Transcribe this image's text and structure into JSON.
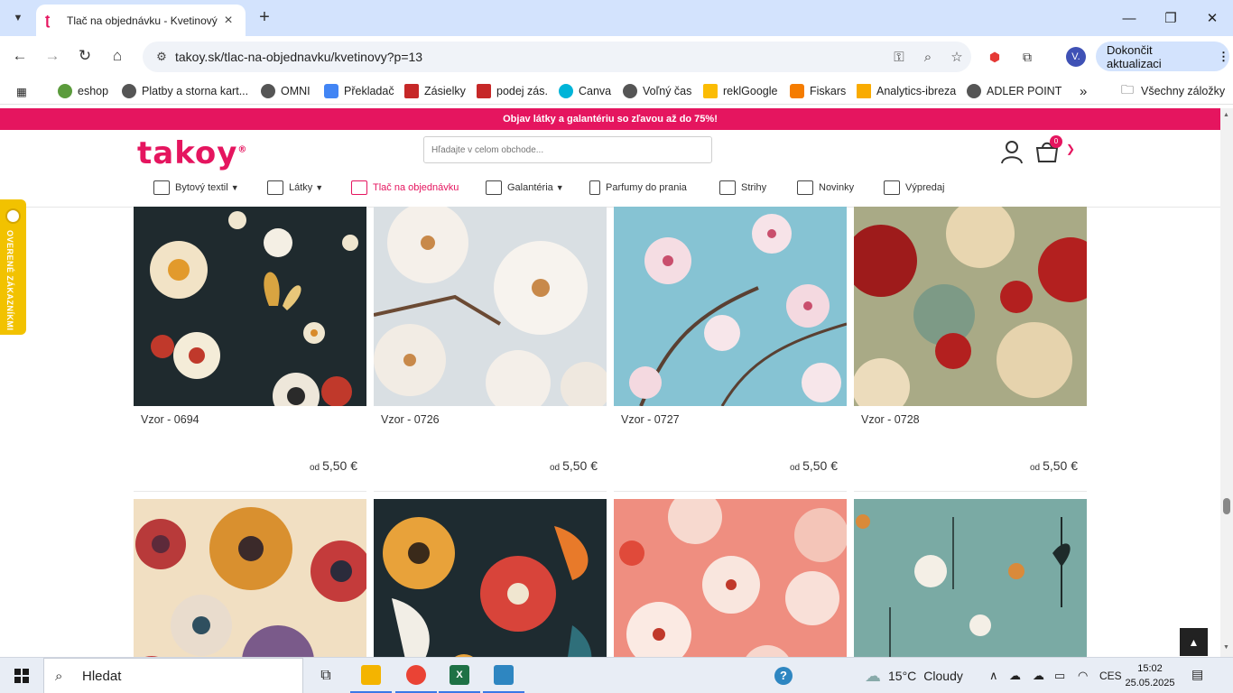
{
  "browser": {
    "tab_title": "Tlač na objednávku - Kvetinový",
    "url": "takoy.sk/tlac-na-objednavku/kvetinovy?p=13",
    "update_button": "Dokončit aktualizaci",
    "profile_initial": "V.",
    "bookmarks": [
      "eshop",
      "Platby a storna kart...",
      "OMNI",
      "Překladač",
      "Zásielky",
      "podej zás.",
      "Canva",
      "Voľný čas",
      "reklGoogle",
      "Fiskars",
      "Analytics-ibreza",
      "ADLER POINT"
    ],
    "all_bookmarks": "Všechny záložky"
  },
  "site": {
    "promo": "Objav látky a galantériu so zľavou až do 75%!",
    "logo": "takoy",
    "logo_mark": "®",
    "search_placeholder": "Hľadajte v celom obchode...",
    "cart_count": "0",
    "nav": [
      {
        "label": "Bytový textil",
        "has_menu": true
      },
      {
        "label": "Látky",
        "has_menu": true
      },
      {
        "label": "Tlač na objednávku",
        "has_menu": false,
        "active": true
      },
      {
        "label": "Galantéria",
        "has_menu": true
      },
      {
        "label": "Parfumy do prania",
        "has_menu": false
      },
      {
        "label": "Strihy",
        "has_menu": false
      },
      {
        "label": "Novinky",
        "has_menu": false
      },
      {
        "label": "Výpredaj",
        "has_menu": false
      }
    ],
    "trust_badge": "OVERENÉ ZÁKAZNÍKMI",
    "price_prefix": "od"
  },
  "products": [
    {
      "name": "Vzor - 0694",
      "price": "5,50 €"
    },
    {
      "name": "Vzor - 0726",
      "price": "5,50 €"
    },
    {
      "name": "Vzor - 0727",
      "price": "5,50 €"
    },
    {
      "name": "Vzor - 0728",
      "price": "5,50 €"
    },
    {
      "name": "",
      "price": ""
    },
    {
      "name": "",
      "price": ""
    },
    {
      "name": "",
      "price": ""
    },
    {
      "name": "",
      "price": ""
    }
  ],
  "taskbar": {
    "search": "Hledat",
    "weather_temp": "15°C",
    "weather_text": "Cloudy",
    "lang": "CES",
    "time": "15:02",
    "date": "25.05.2025"
  },
  "colors": {
    "brand": "#e5155f",
    "trust": "#f2c200",
    "chrome_tabstrip": "#d3e3fd"
  }
}
